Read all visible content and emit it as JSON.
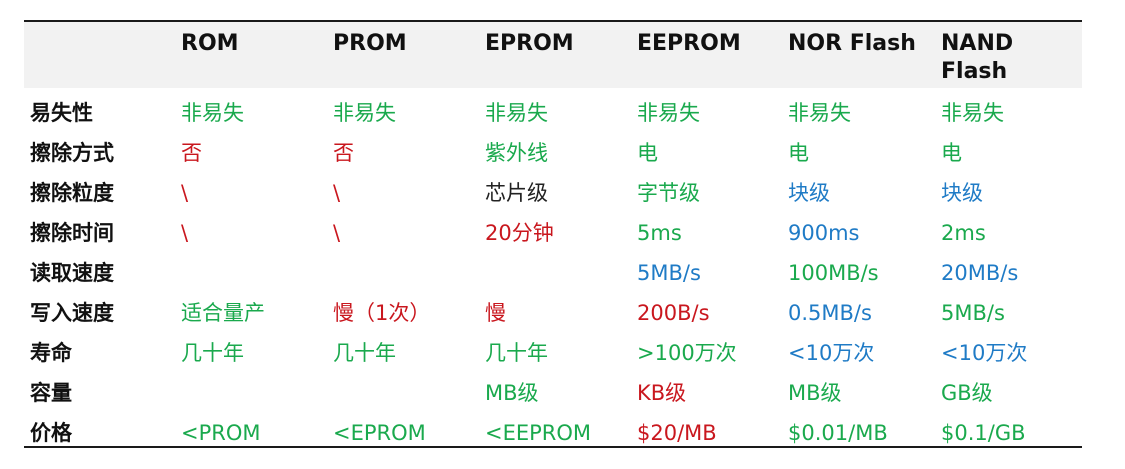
{
  "colors": {
    "green": "#1aa94d",
    "red": "#c9171e",
    "blue": "#1f7bc6",
    "black": "#222222",
    "header_bg": "#f2f2f2"
  },
  "table": {
    "columns": [
      "",
      "ROM",
      "PROM",
      "EPROM",
      "EEPROM",
      "NOR Flash",
      "NAND Flash"
    ],
    "rows": [
      {
        "label": "易失性",
        "cells": [
          {
            "text": "非易失",
            "color": "green"
          },
          {
            "text": "非易失",
            "color": "green"
          },
          {
            "text": "非易失",
            "color": "green"
          },
          {
            "text": "非易失",
            "color": "green"
          },
          {
            "text": "非易失",
            "color": "green"
          },
          {
            "text": "非易失",
            "color": "green"
          }
        ]
      },
      {
        "label": "擦除方式",
        "cells": [
          {
            "text": "否",
            "color": "red"
          },
          {
            "text": "否",
            "color": "red"
          },
          {
            "text": "紫外线",
            "color": "green"
          },
          {
            "text": "电",
            "color": "green"
          },
          {
            "text": "电",
            "color": "green"
          },
          {
            "text": "电",
            "color": "green"
          }
        ]
      },
      {
        "label": "擦除粒度",
        "cells": [
          {
            "text": "\\",
            "color": "red"
          },
          {
            "text": "\\",
            "color": "red"
          },
          {
            "text": "芯片级",
            "color": "black"
          },
          {
            "text": "字节级",
            "color": "green"
          },
          {
            "text": "块级",
            "color": "blue"
          },
          {
            "text": "块级",
            "color": "blue"
          }
        ]
      },
      {
        "label": "擦除时间",
        "cells": [
          {
            "text": "\\",
            "color": "red"
          },
          {
            "text": "\\",
            "color": "red"
          },
          {
            "text": "20分钟",
            "color": "red"
          },
          {
            "text": "5ms",
            "color": "green"
          },
          {
            "text": "900ms",
            "color": "blue"
          },
          {
            "text": "2ms",
            "color": "green"
          }
        ]
      },
      {
        "label": "读取速度",
        "cells": [
          {
            "text": "",
            "color": "black"
          },
          {
            "text": "",
            "color": "black"
          },
          {
            "text": "",
            "color": "black"
          },
          {
            "text": "5MB/s",
            "color": "blue"
          },
          {
            "text": "100MB/s",
            "color": "green"
          },
          {
            "text": "20MB/s",
            "color": "blue"
          }
        ]
      },
      {
        "label": "写入速度",
        "cells": [
          {
            "text": "适合量产",
            "color": "green"
          },
          {
            "text": "慢（1次）",
            "color": "red"
          },
          {
            "text": "慢",
            "color": "red"
          },
          {
            "text": "200B/s",
            "color": "red"
          },
          {
            "text": "0.5MB/s",
            "color": "blue"
          },
          {
            "text": "5MB/s",
            "color": "green"
          }
        ]
      },
      {
        "label": "寿命",
        "cells": [
          {
            "text": "几十年",
            "color": "green"
          },
          {
            "text": "几十年",
            "color": "green"
          },
          {
            "text": "几十年",
            "color": "green"
          },
          {
            "text": ">100万次",
            "color": "green"
          },
          {
            "text": "<10万次",
            "color": "blue"
          },
          {
            "text": "<10万次",
            "color": "blue"
          }
        ]
      },
      {
        "label": "容量",
        "cells": [
          {
            "text": "",
            "color": "black"
          },
          {
            "text": "",
            "color": "black"
          },
          {
            "text": "MB级",
            "color": "green"
          },
          {
            "text": "KB级",
            "color": "red"
          },
          {
            "text": "MB级",
            "color": "green"
          },
          {
            "text": "GB级",
            "color": "green"
          }
        ]
      },
      {
        "label": "价格",
        "cells": [
          {
            "text": "<PROM",
            "color": "green"
          },
          {
            "text": "<EPROM",
            "color": "green"
          },
          {
            "text": "<EEPROM",
            "color": "green"
          },
          {
            "text": "$20/MB",
            "color": "red"
          },
          {
            "text": "$0.01/MB",
            "color": "green"
          },
          {
            "text": "$0.1/GB",
            "color": "green"
          }
        ]
      }
    ]
  }
}
